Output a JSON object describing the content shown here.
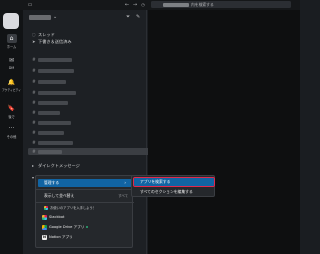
{
  "topbar": {
    "sidebar_icon": "sidebar-toggle-icon",
    "back": "←",
    "forward": "→",
    "history": "🕘",
    "search_suffix": "内を検索する"
  },
  "rail": {
    "items": [
      {
        "icon": "⌂",
        "label": "ホーム"
      },
      {
        "icon": "✉",
        "label": "DM"
      },
      {
        "icon": "🔔",
        "label": "アクティビティ"
      },
      {
        "icon": "🔖",
        "label": "後で"
      },
      {
        "icon": "···",
        "label": "その他"
      }
    ]
  },
  "sidebar": {
    "chevron": "⌄",
    "filter_icon": "filter-icon",
    "compose_icon": "compose-icon",
    "threads": "スレッド",
    "drafts": "下書き＆送信済み",
    "channel_hash": "#",
    "dm_section": "ダイレクトメッセージ",
    "app_section": "App"
  },
  "context_menu": {
    "manage": "管理する",
    "manage_arrow": "›",
    "sort": "表示して並べ替え",
    "sort_shortcut": "すべて",
    "hint": "お使いのアプリを入手しよう！",
    "apps": [
      {
        "name": "Slackbot"
      },
      {
        "name": "Google Drive アプリ"
      },
      {
        "name": "Notion アプリ"
      }
    ]
  },
  "submenu": {
    "browse_apps": "アプリを検索する",
    "edit_sections": "すべてのセクションを編集する"
  },
  "colors": {
    "accent": "#1164a3",
    "highlight_outline": "#e0284d",
    "online": "#2bac76"
  }
}
